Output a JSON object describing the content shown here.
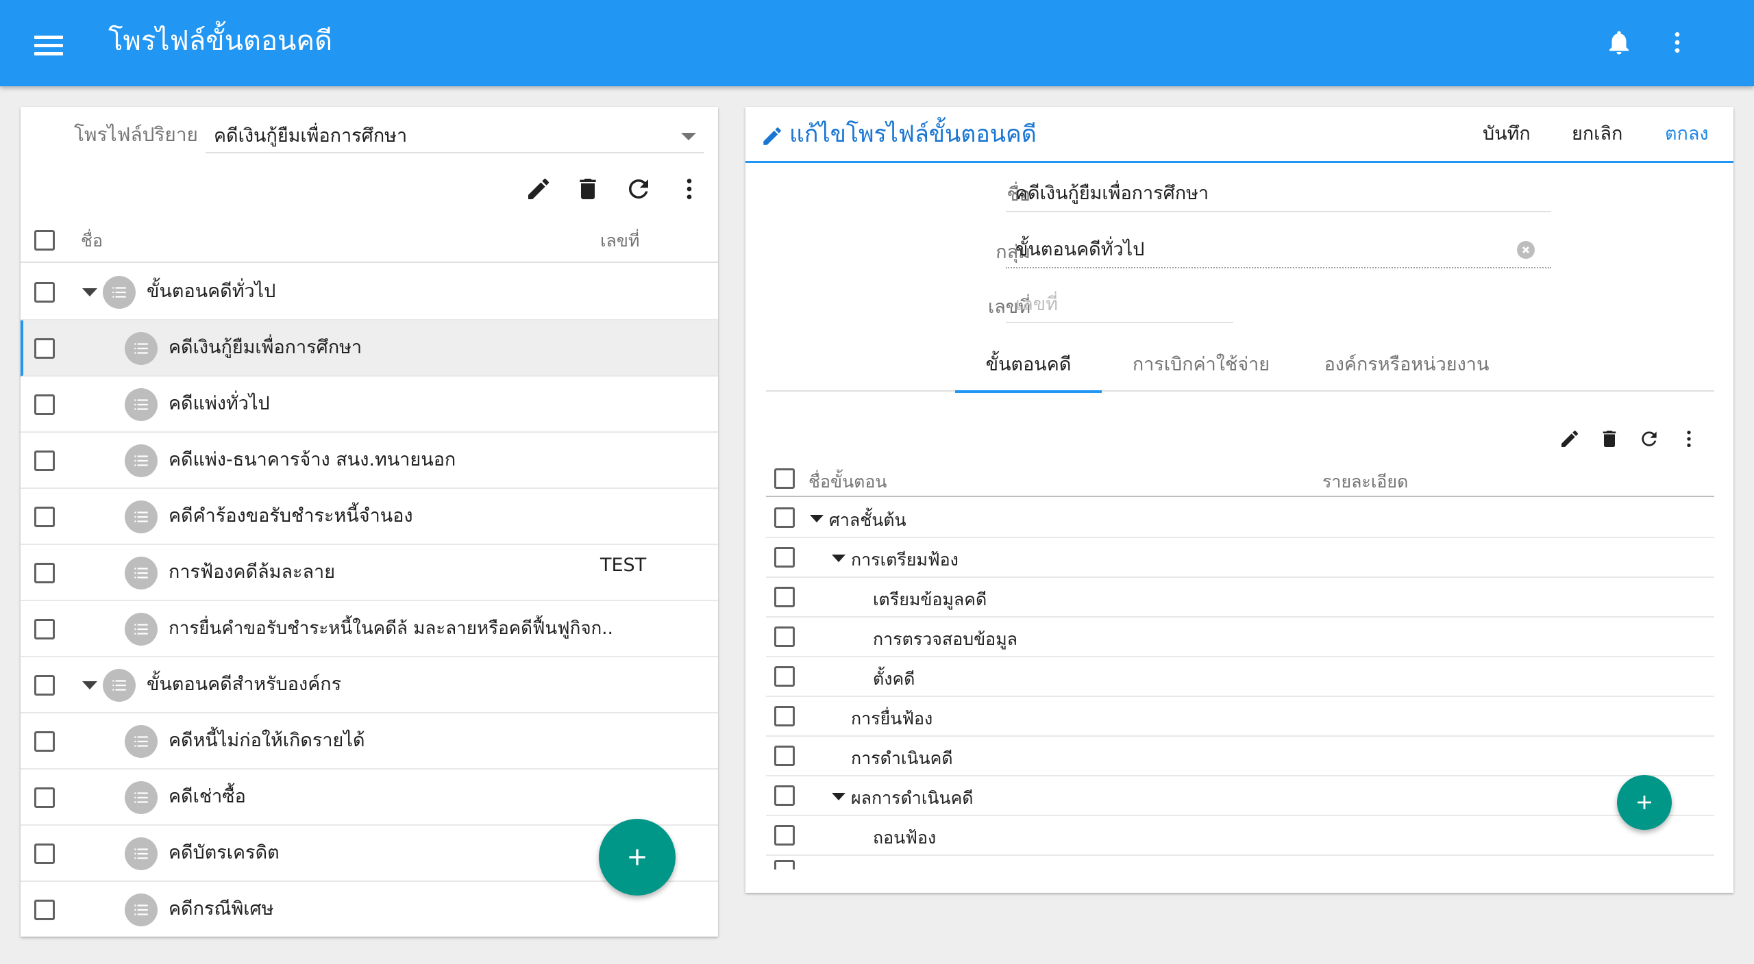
{
  "app": {
    "title": "โพรไฟล์ขั้นตอนคดี",
    "icons": {
      "menu": "hamburger-icon",
      "notifications": "bell-icon",
      "more": "more-vert-icon"
    },
    "colors": {
      "primary": "#2196f3",
      "accent": "#009688",
      "primary_dark_text": "#1976d2"
    }
  },
  "left_panel": {
    "profile_select": {
      "label": "โพรไฟล์ปริยาย",
      "value": "คดีเงินกู้ยืมเพื่อการศึกษา"
    },
    "toolbar": [
      "edit-icon",
      "delete-icon",
      "refresh-icon",
      "more-vert-icon"
    ],
    "columns": {
      "name": "ชื่อ",
      "number": "เลขที่"
    },
    "rows": [
      {
        "label": "ขั้นตอนคดีทั่วไป",
        "number": "",
        "group": true
      },
      {
        "label": "คดีเงินกู้ยืมเพื่อการศึกษา",
        "number": "",
        "selected": true
      },
      {
        "label": "คดีแพ่งทั่วไป",
        "number": ""
      },
      {
        "label": "คดีแพ่ง-ธนาคารจ้าง สนง.ทนายนอก",
        "number": ""
      },
      {
        "label": "คดีคำร้องขอรับชำระหนี้จำนอง",
        "number": ""
      },
      {
        "label": "การฟ้องคดีล้มละลาย",
        "number": "TEST"
      },
      {
        "label": "การยื่นคำขอรับชำระหนี้ในคดีล้ มละลายหรือคดีฟื้นฟูกิจก..",
        "number": ""
      },
      {
        "label": "ขั้นตอนคดีสำหรับองค์กร",
        "number": "",
        "group": true
      },
      {
        "label": "คดีหนี้ไม่ก่อให้เกิดรายได้",
        "number": ""
      },
      {
        "label": "คดีเช่าซื้อ",
        "number": ""
      },
      {
        "label": "คดีบัตรเครดิต",
        "number": ""
      },
      {
        "label": "คดีกรณีพิเศษ",
        "number": ""
      }
    ],
    "fab": "add-icon"
  },
  "right_panel": {
    "title": "แก้ไขโพรไฟล์ขั้นตอนคดี",
    "actions": {
      "save": "บันทึก",
      "cancel": "ยกเลิก",
      "ok": "ตกลง"
    },
    "form": {
      "name_label": "ชื่อ",
      "name_value": "คดีเงินกู้ยืมเพื่อการศึกษา",
      "group_label": "กลุ่ม",
      "group_value": "ขั้นตอนคดีทั่วไป",
      "number_label": "เลขที่",
      "number_placeholder": "เลขที่"
    },
    "tabs": [
      {
        "label": "ขั้นตอนคดี",
        "active": true
      },
      {
        "label": "การเบิกค่าใช้จ่าย",
        "active": false
      },
      {
        "label": "องค์กรหรือหน่วยงาน",
        "active": false
      }
    ],
    "steps_columns": {
      "name": "ชื่อขั้นตอน",
      "detail": "รายละเอียด"
    },
    "steps": [
      {
        "label": "ศาลชั้นต้น",
        "level": 0,
        "expanded": true
      },
      {
        "label": "การเตรียมฟ้อง",
        "level": 1,
        "expanded": true
      },
      {
        "label": "เตรียมข้อมูลคดี",
        "level": 2
      },
      {
        "label": "การตรวจสอบข้อมูล",
        "level": 2
      },
      {
        "label": "ตั้งคดี",
        "level": 2
      },
      {
        "label": "การยื่นฟ้อง",
        "level": 1
      },
      {
        "label": "การดำเนินคดี",
        "level": 1
      },
      {
        "label": "ผลการดำเนินคดี",
        "level": 1,
        "expanded": true
      },
      {
        "label": "ถอนฟ้อง",
        "level": 2
      }
    ]
  }
}
